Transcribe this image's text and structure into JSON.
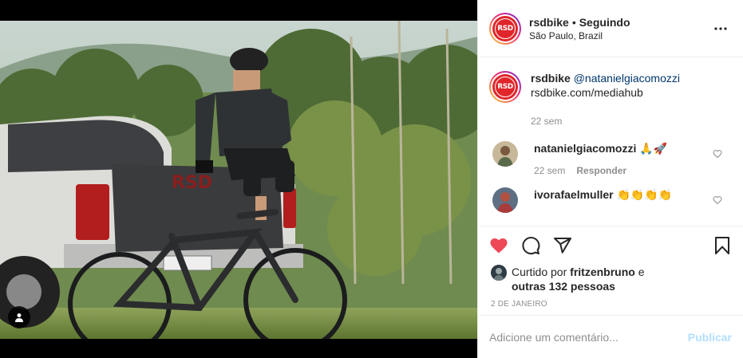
{
  "header": {
    "username": "rsdbike",
    "separator": "•",
    "follow_status": "Seguindo",
    "location": "São Paulo, Brazil",
    "logo_text": "RSD"
  },
  "caption": {
    "username": "rsdbike",
    "mention": "@natanielgiacomozzi",
    "link": "rsdbike.com/mediahub",
    "time": "22 sem"
  },
  "comments": [
    {
      "username": "natanielgiacomozzi",
      "text": "🙏🚀",
      "time": "22 sem",
      "reply_label": "Responder"
    },
    {
      "username": "ivorafaelmuller",
      "text": "👏👏👏👏"
    }
  ],
  "likes": {
    "prefix": "Curtido por",
    "user": "fritzenbruno",
    "connector": "e",
    "others": "outras 132 pessoas"
  },
  "date": "2 DE JANEIRO",
  "add_comment": {
    "placeholder": "Adicione um comentário...",
    "publish_label": "Publicar"
  },
  "colors": {
    "like_red": "#ed4956",
    "brand_red": "#e0262b",
    "link_blue": "#00376b",
    "publish_disabled": "#b2dffc",
    "meta_gray": "#8e8e8e"
  },
  "icons": [
    "more-icon",
    "heart-icon",
    "comment-icon",
    "share-icon",
    "save-icon",
    "user-tag-icon",
    "small-heart-icon"
  ]
}
